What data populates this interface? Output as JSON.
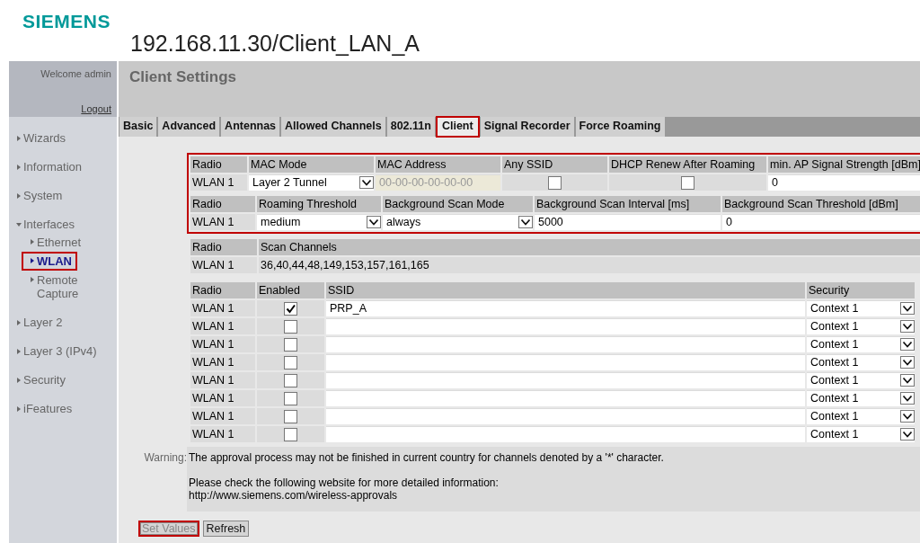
{
  "logo": "SIEMENS",
  "title": "192.168.11.30/Client_LAN_A",
  "sidebar": {
    "welcome": "Welcome admin",
    "logout": "Logout",
    "items": [
      {
        "label": "Wizards",
        "expanded": false
      },
      {
        "label": "Information",
        "expanded": false
      },
      {
        "label": "System",
        "expanded": false
      },
      {
        "label": "Interfaces",
        "expanded": true,
        "children": [
          {
            "label": "Ethernet",
            "selected": false,
            "highlighted": false
          },
          {
            "label": "WLAN",
            "selected": true,
            "highlighted": true
          },
          {
            "label": "Remote Capture",
            "selected": false,
            "highlighted": false
          }
        ]
      },
      {
        "label": "Layer 2",
        "expanded": false
      },
      {
        "label": "Layer 3 (IPv4)",
        "expanded": false
      },
      {
        "label": "Security",
        "expanded": false
      },
      {
        "label": "iFeatures",
        "expanded": false
      }
    ]
  },
  "page_title": "Client Settings",
  "tabs": [
    {
      "label": "Basic",
      "selected": false,
      "highlighted": false
    },
    {
      "label": "Advanced",
      "selected": false,
      "highlighted": false
    },
    {
      "label": "Antennas",
      "selected": false,
      "highlighted": false
    },
    {
      "label": "Allowed Channels",
      "selected": false,
      "highlighted": false
    },
    {
      "label": "802.11n",
      "selected": false,
      "highlighted": false
    },
    {
      "label": "Client",
      "selected": true,
      "highlighted": true
    },
    {
      "label": "Signal Recorder",
      "selected": false,
      "highlighted": false
    },
    {
      "label": "Force Roaming",
      "selected": false,
      "highlighted": false
    }
  ],
  "table_groups": [
    {
      "highlighted": true,
      "tables": [
        {
          "columns": [
            "Radio",
            "MAC Mode",
            "MAC Address",
            "Any SSID",
            "DHCP Renew After Roaming",
            "min. AP Signal Strength [dBm]"
          ],
          "rows": [
            [
              {
                "kind": "text",
                "value": "WLAN 1"
              },
              {
                "kind": "select",
                "value": "Layer 2 Tunnel"
              },
              {
                "kind": "input",
                "value": "00-00-00-00-00-00",
                "disabled": true
              },
              {
                "kind": "checkbox",
                "checked": false
              },
              {
                "kind": "checkbox",
                "checked": false
              },
              {
                "kind": "input",
                "value": "0",
                "disabled": false
              }
            ]
          ]
        },
        {
          "columns": [
            "Radio",
            "Roaming Threshold",
            "Background Scan Mode",
            "Background Scan Interval [ms]",
            "Background Scan Threshold [dBm]"
          ],
          "rows": [
            [
              {
                "kind": "text",
                "value": "WLAN 1"
              },
              {
                "kind": "select",
                "value": "medium"
              },
              {
                "kind": "select",
                "value": "always"
              },
              {
                "kind": "input",
                "value": "5000",
                "disabled": false
              },
              {
                "kind": "input",
                "value": "0",
                "disabled": false
              }
            ]
          ]
        }
      ]
    },
    {
      "highlighted": false,
      "tables": [
        {
          "columns": [
            "Radio",
            "Scan Channels"
          ],
          "rows": [
            [
              {
                "kind": "text",
                "value": "WLAN 1"
              },
              {
                "kind": "text",
                "value": "36,40,44,48,149,153,157,161,165"
              }
            ]
          ]
        }
      ]
    },
    {
      "highlighted": false,
      "tables": [
        {
          "columns": [
            "Radio",
            "Enabled",
            "SSID",
            "Security"
          ],
          "rows": [
            [
              {
                "kind": "text",
                "value": "WLAN 1"
              },
              {
                "kind": "checkbox",
                "checked": true
              },
              {
                "kind": "input",
                "value": "PRP_A",
                "disabled": false
              },
              {
                "kind": "select",
                "value": "Context 1"
              }
            ],
            [
              {
                "kind": "text",
                "value": "WLAN 1"
              },
              {
                "kind": "checkbox",
                "checked": false
              },
              {
                "kind": "input",
                "disabled": false
              },
              {
                "kind": "select",
                "value": "Context 1"
              }
            ],
            [
              {
                "kind": "text",
                "value": "WLAN 1"
              },
              {
                "kind": "checkbox",
                "checked": false
              },
              {
                "kind": "input",
                "disabled": false
              },
              {
                "kind": "select",
                "value": "Context 1"
              }
            ],
            [
              {
                "kind": "text",
                "value": "WLAN 1"
              },
              {
                "kind": "checkbox",
                "checked": false
              },
              {
                "kind": "input",
                "disabled": false
              },
              {
                "kind": "select",
                "value": "Context 1"
              }
            ],
            [
              {
                "kind": "text",
                "value": "WLAN 1"
              },
              {
                "kind": "checkbox",
                "checked": false
              },
              {
                "kind": "input",
                "disabled": false
              },
              {
                "kind": "select",
                "value": "Context 1"
              }
            ],
            [
              {
                "kind": "text",
                "value": "WLAN 1"
              },
              {
                "kind": "checkbox",
                "checked": false
              },
              {
                "kind": "input",
                "disabled": false
              },
              {
                "kind": "select",
                "value": "Context 1"
              }
            ],
            [
              {
                "kind": "text",
                "value": "WLAN 1"
              },
              {
                "kind": "checkbox",
                "checked": false
              },
              {
                "kind": "input",
                "disabled": false
              },
              {
                "kind": "select",
                "value": "Context 1"
              }
            ],
            [
              {
                "kind": "text",
                "value": "WLAN 1"
              },
              {
                "kind": "checkbox",
                "checked": false
              },
              {
                "kind": "input",
                "disabled": false
              },
              {
                "kind": "select",
                "value": "Context 1"
              }
            ]
          ]
        }
      ]
    }
  ],
  "warning": {
    "label": "Warning:",
    "lines": [
      "The approval process may not be finished in current country for channels denoted by a '*' character.",
      "Please check the following website for more detailed information:",
      "http://www.siemens.com/wireless-approvals"
    ]
  },
  "buttons": [
    {
      "label": "Set Values",
      "disabled": true,
      "highlighted": true
    },
    {
      "label": "Refresh",
      "disabled": false,
      "highlighted": false
    }
  ]
}
